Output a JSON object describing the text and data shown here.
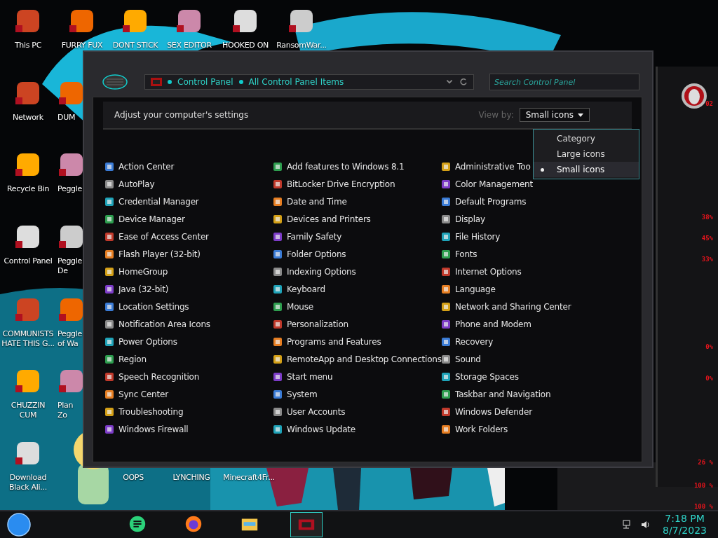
{
  "desktop_icons": [
    {
      "label": "This PC"
    },
    {
      "label": "FURRY FUX"
    },
    {
      "label": "DONT STICK"
    },
    {
      "label": "SEX EDITOR"
    },
    {
      "label": "HOOKED ON"
    },
    {
      "label": "RansomWar..."
    },
    {
      "label": "Network"
    },
    {
      "label": "DUM"
    },
    {
      "label": "Recycle Bin"
    },
    {
      "label": "Peggle"
    },
    {
      "label": "Control Panel"
    },
    {
      "label": "Peggle\nDe"
    },
    {
      "label": "COMMUNISTS\nHATE THIS G..."
    },
    {
      "label": "Peggle\nof Wa"
    },
    {
      "label": "CHUZZIN\nCUM"
    },
    {
      "label": "Plan\nZo"
    },
    {
      "label": "Download\nBlack Ali..."
    },
    {
      "label": "OOPS"
    },
    {
      "label": "LYNCHING"
    },
    {
      "label": "Minecraft4Fr..."
    }
  ],
  "window": {
    "breadcrumbs": [
      "Control Panel",
      "All Control Panel Items"
    ],
    "search": {
      "placeholder": "Search Control Panel"
    },
    "heading": "Adjust your computer's settings",
    "view_by": {
      "label": "View by:",
      "value": "Small icons",
      "options": [
        {
          "label": "Category",
          "selected": false
        },
        {
          "label": "Large icons",
          "selected": false
        },
        {
          "label": "Small icons",
          "selected": true
        }
      ]
    },
    "columns": [
      [
        "Action Center",
        "AutoPlay",
        "Credential Manager",
        "Device Manager",
        "Ease of Access Center",
        "Flash Player (32-bit)",
        "HomeGroup",
        "Java (32-bit)",
        "Location Settings",
        "Notification Area Icons",
        "Power Options",
        "Region",
        "Speech Recognition",
        "Sync Center",
        "Troubleshooting",
        "Windows Firewall"
      ],
      [
        "Add features to Windows 8.1",
        "BitLocker Drive Encryption",
        "Date and Time",
        "Devices and Printers",
        "Family Safety",
        "Folder Options",
        "Indexing Options",
        "Keyboard",
        "Mouse",
        "Personalization",
        "Programs and Features",
        "RemoteApp and Desktop Connections",
        "Start menu",
        "System",
        "User Accounts",
        "Windows Update"
      ],
      [
        "Administrative Too",
        "Color Management",
        "Default Programs",
        "Display",
        "File History",
        "Fonts",
        "Internet Options",
        "Language",
        "Network and Sharing Center",
        "Phone and Modem",
        "Recovery",
        "Sound",
        "Storage Spaces",
        "Taskbar and Navigation",
        "Windows Defender",
        "Work Folders"
      ]
    ]
  },
  "gadget": {
    "readouts": [
      "02",
      "38%",
      "45%",
      "33%",
      "0%",
      "0%",
      "26 %",
      "100 %",
      "100 %"
    ]
  },
  "taskbar": {
    "apps": [
      {
        "selected": false
      },
      {
        "selected": false
      },
      {
        "selected": false
      },
      {
        "selected": true
      }
    ],
    "time": "7:18 PM",
    "date": "8/7/2023"
  }
}
